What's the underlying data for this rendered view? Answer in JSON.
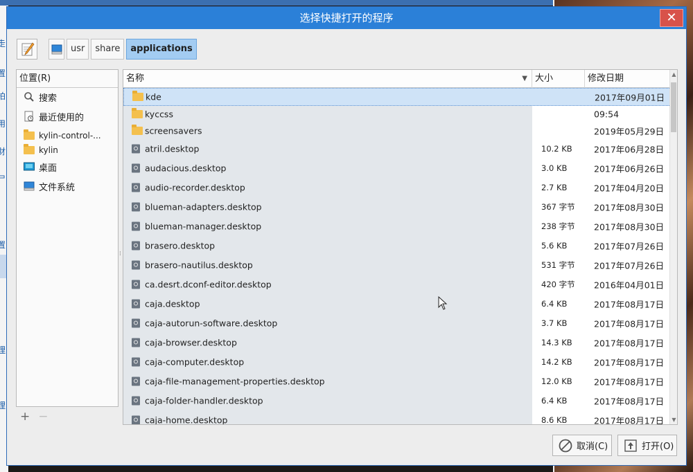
{
  "dialog": {
    "title": "选择快捷打开的程序",
    "close_label": "✕"
  },
  "breadcrumb": [
    {
      "label": ""
    },
    {
      "label": "usr"
    },
    {
      "label": "share"
    },
    {
      "label": "applications"
    }
  ],
  "sidebar": {
    "header": "位置(R)",
    "items": [
      {
        "label": "搜索",
        "icon": "search-icon"
      },
      {
        "label": "最近使用的",
        "icon": "recent-icon"
      },
      {
        "label": "kylin-control-...",
        "icon": "folder-icon"
      },
      {
        "label": "kylin",
        "icon": "folder-icon"
      },
      {
        "label": "桌面",
        "icon": "desktop-icon"
      },
      {
        "label": "文件系统",
        "icon": "drive-icon"
      }
    ],
    "add_label": "+",
    "remove_label": "−"
  },
  "columns": {
    "name": "名称",
    "sort_indicator": "▼",
    "size": "大小",
    "modified": "修改日期"
  },
  "files": [
    {
      "name": "kde",
      "size": "",
      "date": "2017年09月01日",
      "type": "folder",
      "selected": true
    },
    {
      "name": "kyccss",
      "size": "",
      "date": "09:54",
      "type": "folder"
    },
    {
      "name": "screensavers",
      "size": "",
      "date": "2019年05月29日",
      "type": "folder"
    },
    {
      "name": "atril.desktop",
      "size": "10.2 KB",
      "date": "2017年06月28日",
      "type": "file"
    },
    {
      "name": "audacious.desktop",
      "size": "3.0 KB",
      "date": "2017年06月26日",
      "type": "file"
    },
    {
      "name": "audio-recorder.desktop",
      "size": "2.7 KB",
      "date": "2017年04月20日",
      "type": "file"
    },
    {
      "name": "blueman-adapters.desktop",
      "size": "367 字节",
      "date": "2017年08月30日",
      "type": "file"
    },
    {
      "name": "blueman-manager.desktop",
      "size": "238 字节",
      "date": "2017年08月30日",
      "type": "file"
    },
    {
      "name": "brasero.desktop",
      "size": "5.6 KB",
      "date": "2017年07月26日",
      "type": "file"
    },
    {
      "name": "brasero-nautilus.desktop",
      "size": "531 字节",
      "date": "2017年07月26日",
      "type": "file"
    },
    {
      "name": "ca.desrt.dconf-editor.desktop",
      "size": "420 字节",
      "date": "2016年04月01日",
      "type": "file"
    },
    {
      "name": "caja.desktop",
      "size": "6.4 KB",
      "date": "2017年08月17日",
      "type": "file"
    },
    {
      "name": "caja-autorun-software.desktop",
      "size": "3.7 KB",
      "date": "2017年08月17日",
      "type": "file"
    },
    {
      "name": "caja-browser.desktop",
      "size": "14.3 KB",
      "date": "2017年08月17日",
      "type": "file"
    },
    {
      "name": "caja-computer.desktop",
      "size": "14.2 KB",
      "date": "2017年08月17日",
      "type": "file"
    },
    {
      "name": "caja-file-management-properties.desktop",
      "size": "12.0 KB",
      "date": "2017年08月17日",
      "type": "file"
    },
    {
      "name": "caja-folder-handler.desktop",
      "size": "6.4 KB",
      "date": "2017年08月17日",
      "type": "file"
    },
    {
      "name": "caja-home.desktop",
      "size": "8.6 KB",
      "date": "2017年08月17日",
      "type": "file"
    }
  ],
  "buttons": {
    "cancel": "取消(C)",
    "open": "打开(O)"
  },
  "background_chars": [
    "走",
    "置",
    "拍",
    "用",
    "財",
    "尸",
    "置",
    "理",
    "理"
  ],
  "colors": {
    "titlebar": "#2b80d8",
    "selection": "#cfe3f7",
    "breadcrumb_active": "#a3ccf2",
    "close": "#d8524a"
  }
}
